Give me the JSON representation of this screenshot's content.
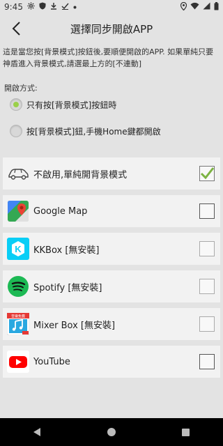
{
  "status_bar": {
    "time": "9:45"
  },
  "header": {
    "title": "選擇同步開啟APP"
  },
  "description": "這是當您按[背景模式]按鈕後,要順便開啟的APP. 如果單純只要神盾進入背景模式,請選最上方的[不連動]",
  "mode": {
    "label": "開啟方式:",
    "options": [
      {
        "label": "只有按[背景模式]按鈕時",
        "selected": true
      },
      {
        "label": "按[背景模式]鈕,手機Home鍵都開啟",
        "selected": false
      }
    ]
  },
  "apps": [
    {
      "label": "不啟用,單純開背景模式",
      "icon": "car-icon",
      "checked": true
    },
    {
      "label": "Google Map",
      "icon": "google-maps-icon",
      "checked": false
    },
    {
      "label": "KKBox [無安裝]",
      "icon": "kkbox-icon",
      "checked": false,
      "disabled": true
    },
    {
      "label": "Spotify [無安裝]",
      "icon": "spotify-icon",
      "checked": false,
      "disabled": true
    },
    {
      "label": "Mixer Box [無安裝]",
      "icon": "mixerbox-icon",
      "checked": false,
      "disabled": true,
      "icon_text": "音樂免費"
    },
    {
      "label": "YouTube",
      "icon": "youtube-icon",
      "checked": false
    }
  ],
  "colors": {
    "radio_selected": "#9ad04a",
    "check_mark": "#7cb342",
    "background": "#e3e3e3"
  }
}
